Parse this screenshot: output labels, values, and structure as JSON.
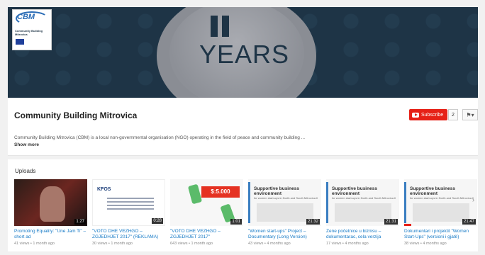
{
  "banner": {
    "logo_text": "CBM",
    "logo_caption": "Community Building Mitrovica",
    "banner_text": "YEARS"
  },
  "header": {
    "channel_name": "Community Building Mitrovica",
    "subscribe_label": "Subscribe",
    "subscriber_count": "2",
    "flag_label": "⚑▾",
    "description": "Community Building Mitrovica (CBM) is a local non-governmental organisation (NGO) operating in the field of peace and community building ...",
    "show_more": "Show more"
  },
  "uploads": {
    "title": "Uploads",
    "next_icon": "chevron-right-icon",
    "videos": [
      {
        "title": "Promoting Equality: \"Une Jam Ti\" – short ad",
        "meta": "41 views • 1 month ago",
        "duration": "1:27"
      },
      {
        "title": "\"VOTO DHE VËZHGO – ZGJEDHJET 2017\" (REKLAMA)",
        "meta": "30 views • 1 month ago",
        "duration": "0:28",
        "thumb_text": "KFOS"
      },
      {
        "title": "\"VOTO DHE VËZHGO – ZGJEDHJET 2017\"",
        "meta": "643 views • 1 month ago",
        "duration": "1:01",
        "thumb_text": "$:5.000"
      },
      {
        "title": "\"Women start-ups\" Project – Documentary (Long Version)",
        "meta": "43 views • 4 months ago",
        "duration": "21:32",
        "thumb_text": "Supportive business environment",
        "thumb_sub": "for women start-ups in North and South Mitrovica Il"
      },
      {
        "title": "Žene početnice u biznisu – dokumentarac, cela verzija",
        "meta": "17 views • 4 months ago",
        "duration": "21:31",
        "thumb_text": "Supportive business environment",
        "thumb_sub": "for women start-ups in North and South Mitrovica Il"
      },
      {
        "title": "Dokumentari i projektit \"Women Start-Ups\" (versioni i gjatë)",
        "meta": "38 views • 4 months ago",
        "duration": "21:47",
        "thumb_text": "Supportive business environment",
        "thumb_sub": "for women start-ups in North and South Mitrovica Il",
        "progress": 0.1
      }
    ]
  },
  "colors": {
    "subscribe": "#e62117",
    "link": "#167ac6",
    "banner": "#1e3446"
  }
}
